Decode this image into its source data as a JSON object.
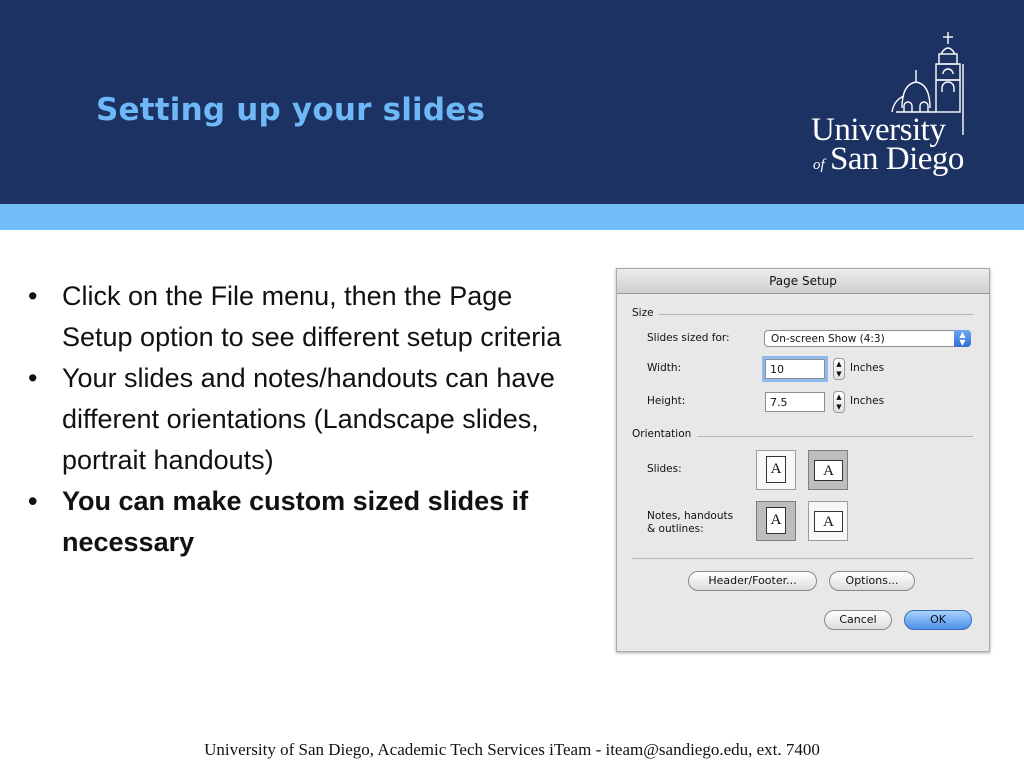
{
  "slide": {
    "title": "Setting up your slides",
    "logo": {
      "line1": "University",
      "of": "of",
      "line2": "San Diego"
    },
    "bullets": [
      "Click on the File menu, then the Page Setup option to see different setup criteria",
      "Your slides and notes/handouts can have different orientations (Landscape slides, portrait handouts)",
      "You can make custom sized slides if necessary"
    ],
    "bullet_symbol": "•",
    "footer": "University of San Diego, Academic Tech Services iTeam - iteam@sandiego.edu, ext. 7400"
  },
  "dialog": {
    "title": "Page Setup",
    "size_group": "Size",
    "slides_sized_for_label": "Slides sized for:",
    "slides_sized_for_value": "On-screen Show (4:3)",
    "width_label": "Width:",
    "width_value": "10",
    "width_unit": "Inches",
    "height_label": "Height:",
    "height_value": "7.5",
    "height_unit": "Inches",
    "orientation_group": "Orientation",
    "slides_label": "Slides:",
    "notes_label_1": "Notes, handouts",
    "notes_label_2": "& outlines:",
    "page_glyph": "A",
    "header_footer_button": "Header/Footer...",
    "options_button": "Options...",
    "cancel_button": "Cancel",
    "ok_button": "OK"
  },
  "colors": {
    "header": "#1b3263",
    "band": "#73bdf9",
    "title": "#6fb8f7"
  }
}
